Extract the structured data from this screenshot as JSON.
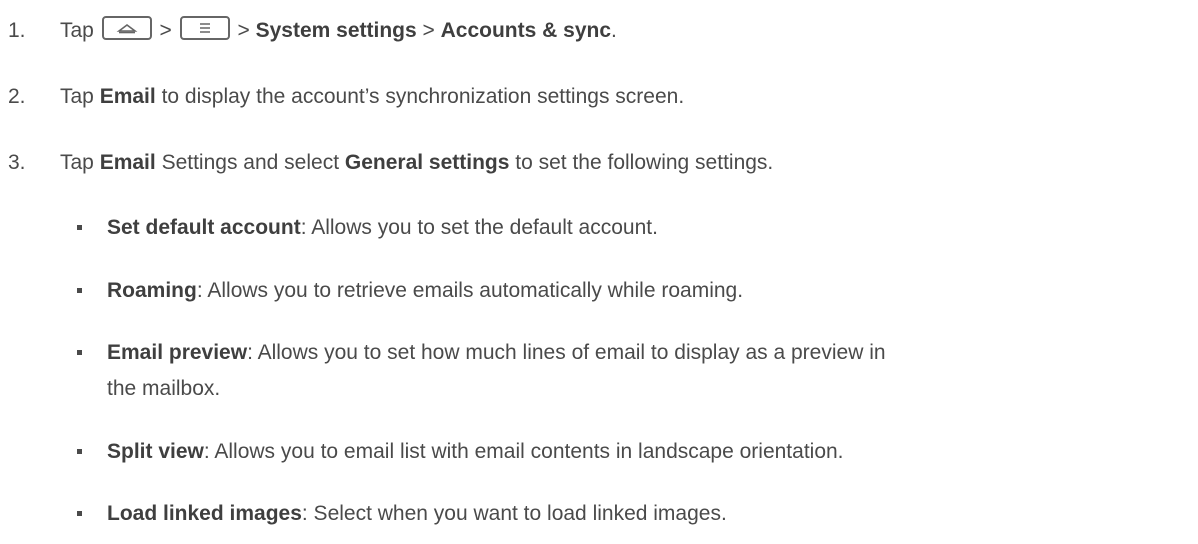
{
  "steps": [
    {
      "num": "1.",
      "parts": {
        "tap": "Tap",
        "sep1": ">",
        "sep2": ">",
        "bold1": "System settings",
        "sep3": ">",
        "bold2": "Accounts & sync",
        "end": "."
      },
      "icons": [
        "home-key-icon",
        "menu-key-icon"
      ]
    },
    {
      "num": "2.",
      "parts": {
        "tap": "Tap",
        "bold1": "Email",
        "rest": "to display the account’s synchronization settings screen."
      }
    },
    {
      "num": "3.",
      "parts": {
        "tap": "Tap",
        "bold1": "Email",
        "mid": "Settings and select",
        "bold2": "General settings",
        "rest": "to set the following settings."
      }
    }
  ],
  "bullets": [
    {
      "title": "Set default account",
      "desc": ": Allows you to set the default account."
    },
    {
      "title": "Roaming",
      "desc": ": Allows you to retrieve emails automatically while roaming."
    },
    {
      "title": "Email preview",
      "desc": ": Allows you to set how much lines of email to display as a preview in",
      "desc2": "the mailbox."
    },
    {
      "title": "Split view",
      "desc": ": Allows you to email list with email contents in landscape orientation."
    },
    {
      "title": "Load linked images",
      "desc": ": Select when you want to load linked images."
    }
  ]
}
